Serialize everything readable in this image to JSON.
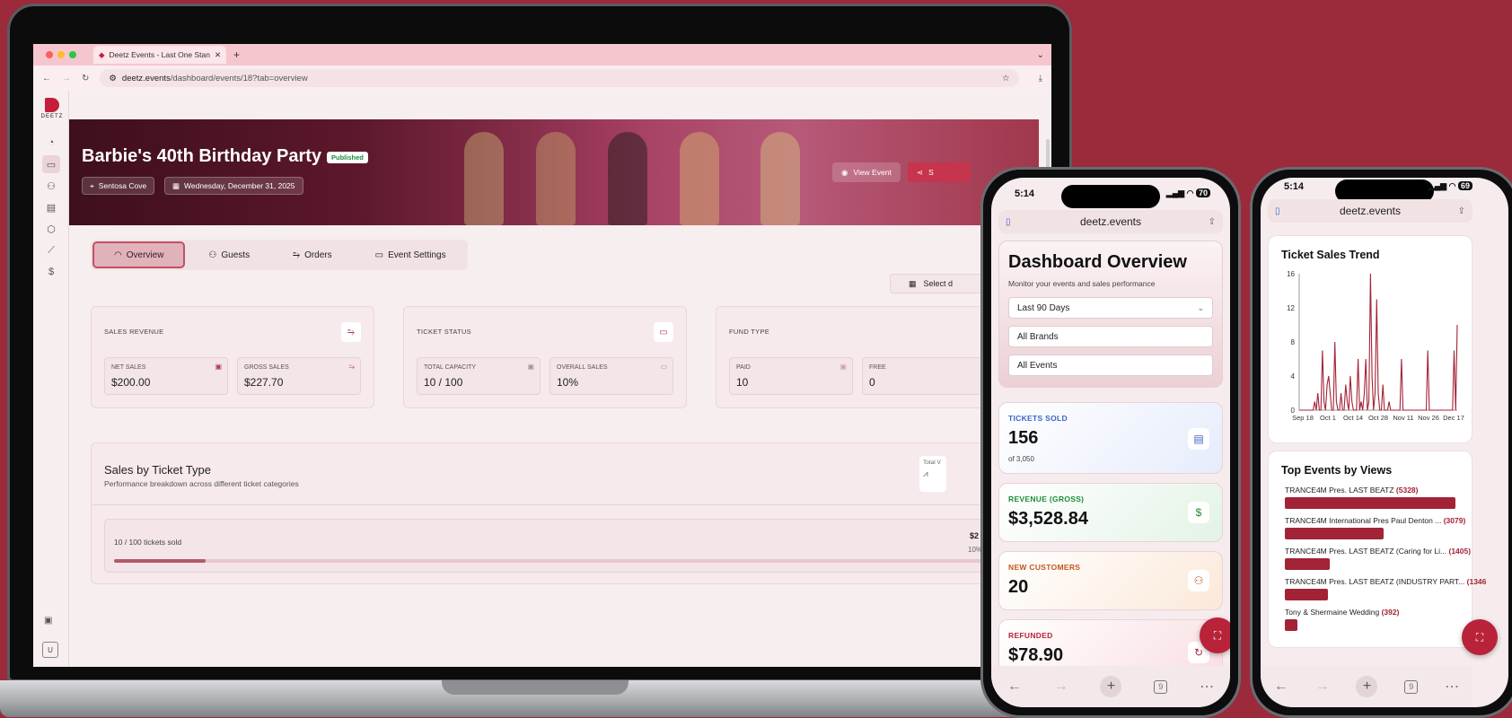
{
  "browser": {
    "tab_title": "Deetz Events - Last One Stan",
    "url_domain": "deetz.events",
    "url_path": "/dashboard/events/18?tab=overview"
  },
  "sidebar": {
    "logo_text": "DEETZ",
    "user_initial": "U"
  },
  "event": {
    "title": "Barbie's 40th Birthday Party",
    "status": "Published",
    "location": "Sentosa Cove",
    "date": "Wednesday, December 31, 2025",
    "view_event_label": "View Event",
    "share_label": "S"
  },
  "tabs": [
    {
      "label": "Overview",
      "icon": "gauge-icon",
      "active": true
    },
    {
      "label": "Guests",
      "icon": "users-icon"
    },
    {
      "label": "Orders",
      "icon": "route-icon"
    },
    {
      "label": "Event Settings",
      "icon": "briefcase-icon"
    }
  ],
  "date_select_label": "Select d",
  "stat_cards": [
    {
      "title": "SALES REVENUE",
      "items": [
        {
          "label": "NET SALES",
          "value": "$200.00"
        },
        {
          "label": "GROSS SALES",
          "value": "$227.70"
        }
      ]
    },
    {
      "title": "TICKET STATUS",
      "items": [
        {
          "label": "TOTAL CAPACITY",
          "value": "10 / 100"
        },
        {
          "label": "OVERALL SALES",
          "value": "10%"
        }
      ]
    },
    {
      "title": "FUND TYPE",
      "items": [
        {
          "label": "PAID",
          "value": "10"
        },
        {
          "label": "FREE",
          "value": "0"
        }
      ]
    }
  ],
  "sales_by_type": {
    "title": "Sales by Ticket Type",
    "description": "Performance breakdown across different ticket categories",
    "total_label": "Total V",
    "tickets_sold_text": "10 / 100 tickets sold",
    "amount": "$2",
    "percent": "10%",
    "progress": 0.1
  },
  "phone1": {
    "time": "5:14",
    "battery": "70",
    "address": "deetz.events",
    "title": "Dashboard Overview",
    "subtitle": "Monitor your events and sales performance",
    "filter_range": "Last 90 Days",
    "filter_brands": "All Brands",
    "filter_events": "All Events",
    "tickets_label": "TICKETS SOLD",
    "tickets_value": "156",
    "tickets_sub": "of 3,050",
    "revenue_label": "REVENUE (GROSS)",
    "revenue_value": "$3,528.84",
    "customers_label": "NEW CUSTOMERS",
    "customers_value": "20",
    "refunded_label": "REFUNDED",
    "refunded_value": "$78.90",
    "tab_count": "9",
    "colors": {
      "tickets": "#3b63c9",
      "revenue": "#1f8a3a",
      "customers": "#c2571a",
      "refunded": "#b8233a"
    }
  },
  "phone2": {
    "time": "5:14",
    "battery": "69",
    "address": "deetz.events",
    "trend_title": "Ticket Sales Trend",
    "top_title": "Top Events by Views",
    "events": [
      {
        "name": "TRANCE4M Pres. LAST BEATZ",
        "views": "(5328)",
        "value": 5328
      },
      {
        "name": "TRANCE4M International Pres Paul Denton ...",
        "views": "(3079)",
        "value": 3079
      },
      {
        "name": "TRANCE4M Pres. LAST BEATZ (Caring for Li...",
        "views": "(1405)",
        "value": 1405
      },
      {
        "name": "TRANCE4M Pres. LAST BEATZ (INDUSTRY PART...",
        "views": "(1346",
        "value": 1346
      },
      {
        "name": "Tony & Shermaine Wedding",
        "views": "(392)",
        "value": 392
      }
    ],
    "tab_count": "9"
  },
  "chart_data": {
    "type": "line",
    "title": "Ticket Sales Trend",
    "x_tick_labels": [
      "Sep 18",
      "Oct 1",
      "Oct 14",
      "Oct 28",
      "Nov 11",
      "Nov 26",
      "Dec 17"
    ],
    "y_ticks": [
      0,
      4,
      8,
      12,
      16
    ],
    "ylim": [
      0,
      16
    ],
    "series": [
      {
        "values": [
          0,
          0,
          0,
          0,
          0,
          0,
          0,
          0,
          0,
          0,
          1,
          0,
          2,
          0,
          0,
          7,
          1,
          0,
          3,
          4,
          2,
          0,
          0,
          8,
          1,
          0,
          0,
          2,
          0,
          0,
          3,
          1,
          0,
          4,
          1,
          0,
          0,
          0,
          6,
          0,
          1,
          0,
          2,
          6,
          0,
          1,
          16,
          4,
          0,
          2,
          13,
          2,
          0,
          0,
          3,
          0,
          0,
          0,
          1,
          0,
          0,
          0,
          0,
          0,
          0,
          0,
          6,
          0,
          0,
          0,
          0,
          0,
          0,
          0,
          0,
          0,
          0,
          0,
          0,
          0,
          0,
          0,
          0,
          7,
          0,
          0,
          0,
          0,
          0,
          0,
          0,
          0,
          0,
          0,
          0,
          0,
          0,
          0,
          0,
          0,
          7,
          0,
          10
        ],
        "color": "#a32336"
      }
    ],
    "grid": false
  }
}
